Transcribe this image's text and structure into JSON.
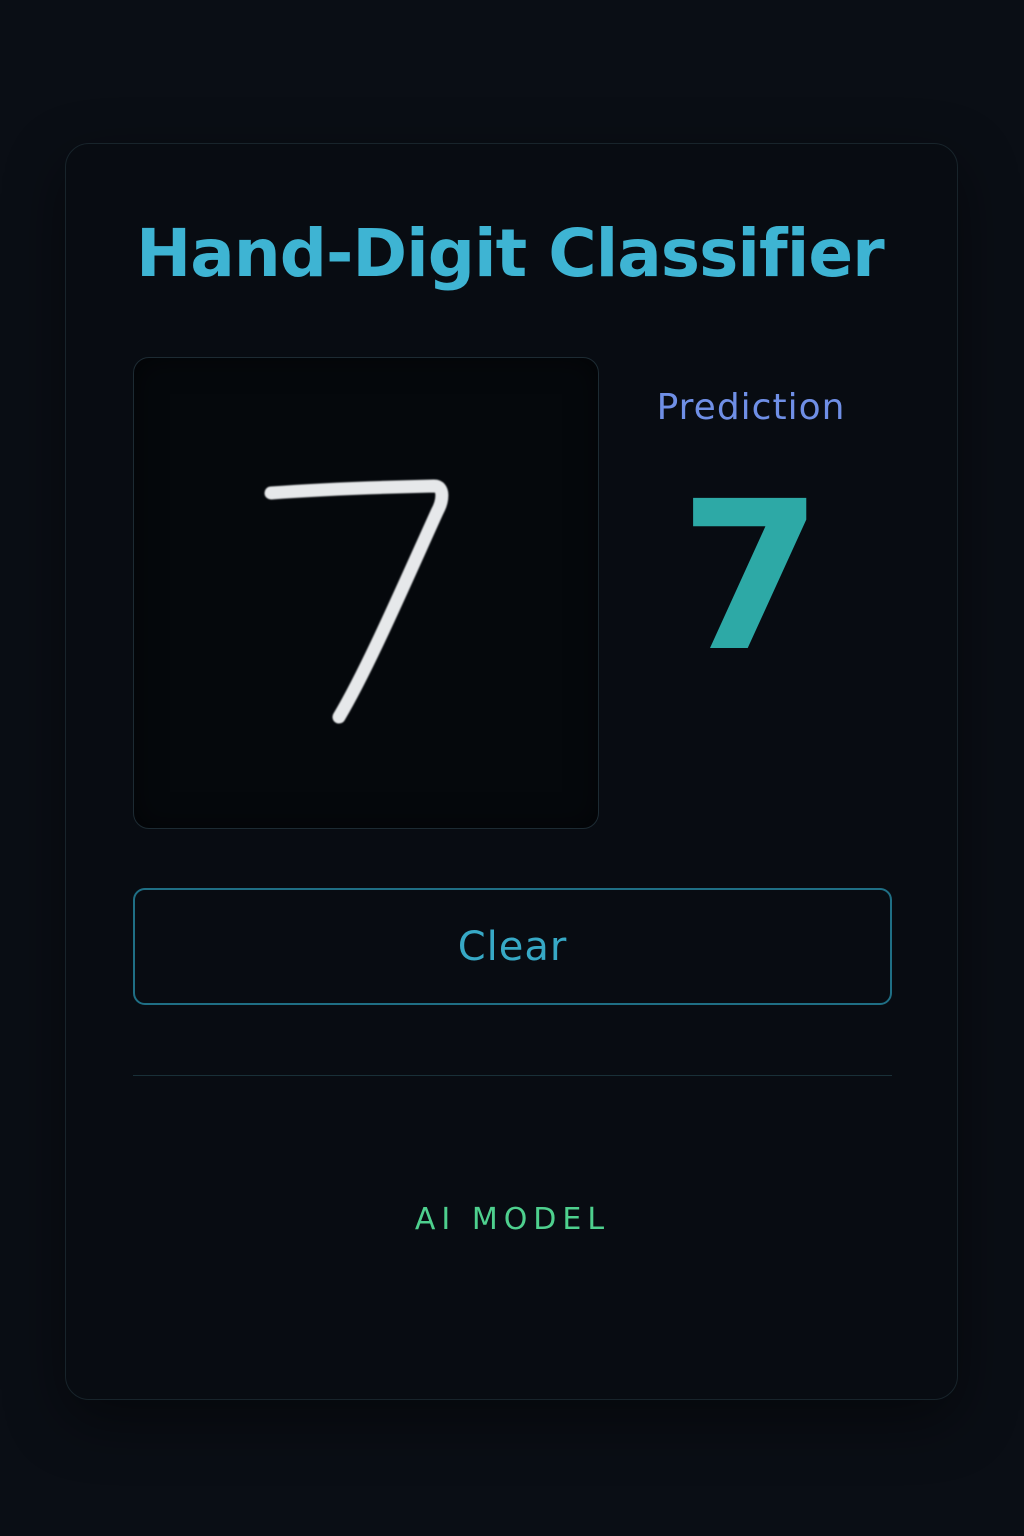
{
  "app": {
    "title": "Hand-Digit Classifier"
  },
  "canvas": {
    "drawn_digit": "7",
    "stroke_color": "#e6e8ea"
  },
  "prediction": {
    "label": "Prediction",
    "value": "7"
  },
  "actions": {
    "clear_label": "Clear"
  },
  "footer": {
    "label": "AI MODEL"
  },
  "colors": {
    "background": "#0a0e15",
    "card": "#080c12",
    "title": "#3eb4d3",
    "prediction_label": "#6f8fe6",
    "prediction_value": "#2da9a6",
    "button_text": "#37a9c6",
    "button_border": "#1f6f85",
    "footer": "#4ed08e"
  },
  "icons": {
    "canvas_stroke": "handwritten-digit-stroke"
  }
}
